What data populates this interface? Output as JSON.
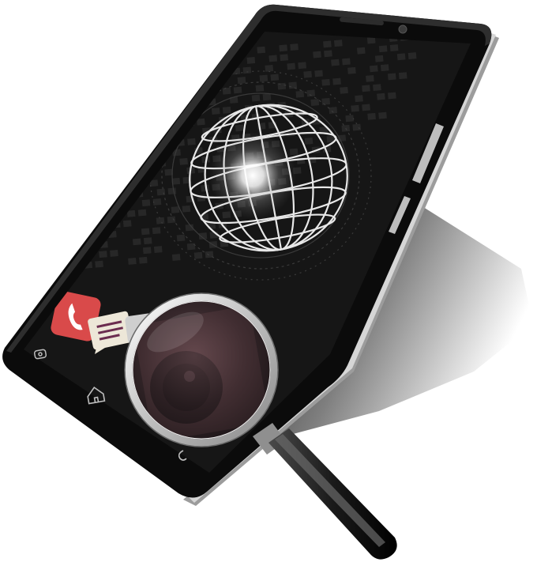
{
  "scene": {
    "subject": "phone-with-magnifier",
    "background_color": "#ffffff",
    "phone_body_color": "#0b0b0b",
    "screen_color": "#171717",
    "accent_colors": {
      "phone_app_icon": "#d94a4a",
      "message_app_icon": "#ede7d8",
      "message_lines": "#6b2c4f",
      "lens_tint": "#5a3a3f",
      "magnifier_rim": "#d9d9d9",
      "magnifier_handle": "#2a2a2a"
    },
    "icons": {
      "phone_app": "phone-icon",
      "message_app": "message-icon",
      "nav_left": "recent-apps-icon",
      "nav_center": "home-icon",
      "nav_right": "back-icon",
      "globe": "globe-wireframe-icon",
      "magnifier": "magnifying-glass-icon"
    }
  }
}
